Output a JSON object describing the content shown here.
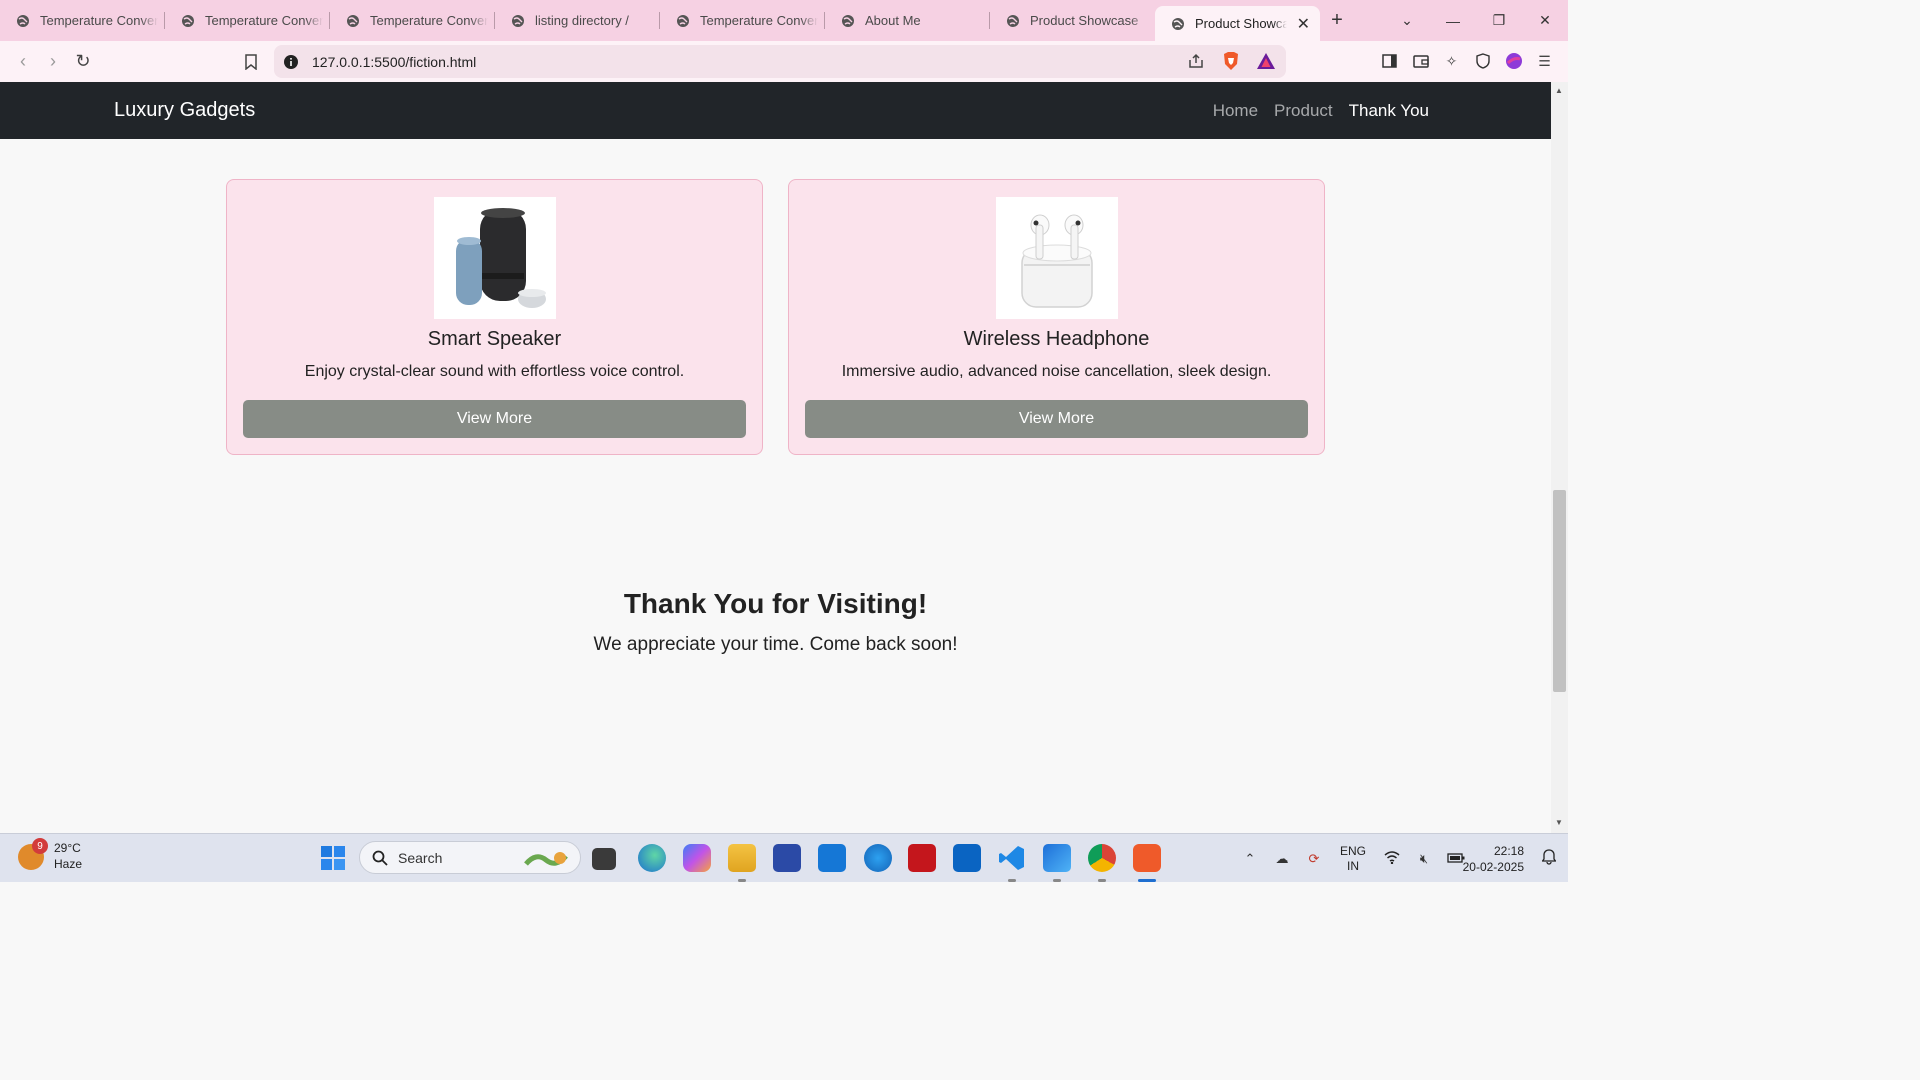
{
  "browser": {
    "tabs": [
      {
        "title": "Temperature Converte"
      },
      {
        "title": "Temperature Converte"
      },
      {
        "title": "Temperature Converte"
      },
      {
        "title": "listing directory /"
      },
      {
        "title": "Temperature Converte"
      },
      {
        "title": "About Me"
      },
      {
        "title": "Product Showcase"
      },
      {
        "title": "Product Showcase",
        "active": true
      }
    ],
    "url": "127.0.0.1:5500/fiction.html"
  },
  "site": {
    "brand": "Luxury Gadgets",
    "nav": [
      "Home",
      "Product",
      "Thank You"
    ],
    "active_nav": "Thank You"
  },
  "products": [
    {
      "title": "Smart Speaker",
      "description": "Enjoy crystal-clear sound with effortless voice control.",
      "button": "View More"
    },
    {
      "title": "Wireless Headphone",
      "description": "Immersive audio, advanced noise cancellation, sleek design.",
      "button": "View More"
    }
  ],
  "thanks": {
    "heading": "Thank You for Visiting!",
    "message": "We appreciate your time. Come back soon!"
  },
  "taskbar": {
    "weather_temp": "29°C",
    "weather_desc": "Haze",
    "weather_badge": "9",
    "search_label": "Search",
    "language": "ENG",
    "region": "IN",
    "time": "22:18",
    "date": "20-02-2025"
  },
  "colors": {
    "tab_strip": "#f6d1e3",
    "navbar": "#212529",
    "card_bg": "#fbe3ec",
    "card_border": "#efb4c7",
    "button": "#878c86"
  }
}
